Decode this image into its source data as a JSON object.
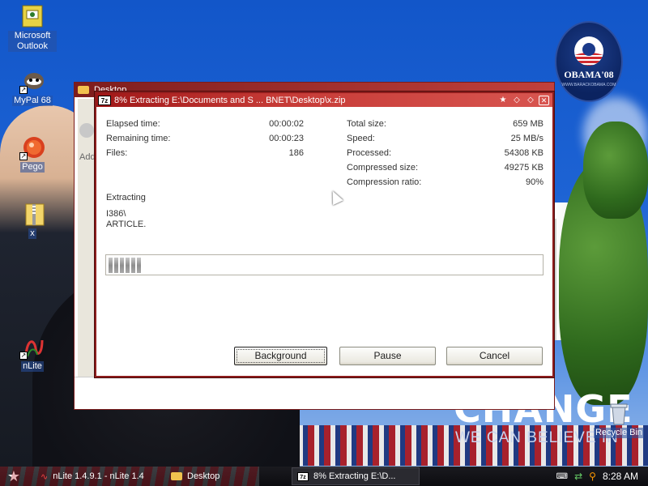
{
  "desktop": {
    "icons": [
      {
        "label": "Microsoft Outlook",
        "icon": "outlook-icon"
      },
      {
        "label": "MyPal 68",
        "icon": "mypal-icon"
      },
      {
        "label": "Pego",
        "icon": "pego-icon"
      },
      {
        "label": "x",
        "icon": "zip-folder-icon"
      },
      {
        "label": "nLite",
        "icon": "nlite-icon"
      },
      {
        "label": "Recycle Bin",
        "icon": "recycle-bin-icon"
      }
    ],
    "wallpaper": {
      "badge_text": "OBAMA'08",
      "badge_subtext": "WWW.BARACKOBAMA.COM",
      "slogan": "CHANGE",
      "slogan_sub": "WE CAN BELIEVE IN"
    }
  },
  "background_window": {
    "title": "Desktop",
    "partial_label": "Add"
  },
  "dialog": {
    "title": "8% Extracting E:\\Documents and S ... BNET\\Desktop\\x.zip",
    "left_stats": [
      {
        "label": "Elapsed time:",
        "value": "00:00:02"
      },
      {
        "label": "Remaining time:",
        "value": "00:00:23"
      },
      {
        "label": "Files:",
        "value": "186"
      }
    ],
    "right_stats": [
      {
        "label": "Total size:",
        "value": "659 MB"
      },
      {
        "label": "Speed:",
        "value": "25 MB/s"
      },
      {
        "label": "Processed:",
        "value": "54308 KB"
      },
      {
        "label": "Compressed size:",
        "value": "49275 KB"
      },
      {
        "label": "Compression ratio:",
        "value": "90%"
      }
    ],
    "action_label": "Extracting",
    "current_path": "I386\\",
    "current_file": "ARTICLE.",
    "progress": 0.08,
    "buttons": {
      "background": "Background",
      "pause": "Pause",
      "cancel": "Cancel"
    }
  },
  "taskbar": {
    "tasks": [
      {
        "label": "nLite 1.4.9.1 - nLite 1.4",
        "icon": "nlite-icon"
      },
      {
        "label": "Desktop",
        "icon": "folder-icon"
      },
      {
        "label": "8% Extracting E:\\D...",
        "icon": "7zip-icon",
        "active": true
      }
    ],
    "clock": "8:28 AM"
  },
  "colors": {
    "titlebar_red": "#a01818",
    "sky_blue": "#1d63d4"
  }
}
